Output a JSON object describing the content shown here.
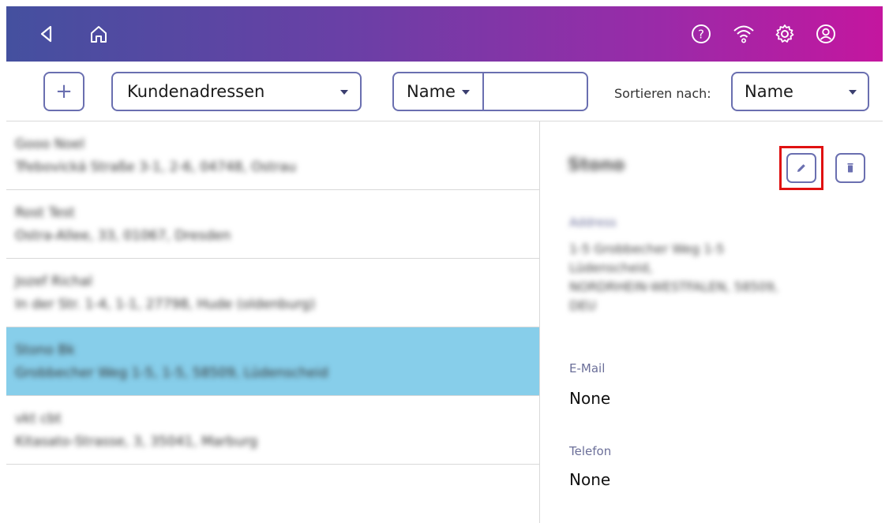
{
  "topbar": {
    "icons": [
      "back-icon",
      "home-icon",
      "help-icon",
      "wifi-icon",
      "settings-icon",
      "account-icon"
    ],
    "gradient": [
      "#44509f",
      "#c4169f"
    ]
  },
  "toolbar": {
    "add_label": "+",
    "address_book": "Kundenadressen",
    "search_field": "Name",
    "search_value": "",
    "sort_label": "Sortieren nach:",
    "sort_value": "Name"
  },
  "list": {
    "selected_index": 3,
    "selected_color": "#87ceea",
    "items": [
      {
        "name": "Gooo Noel",
        "address": "Třebovická Straße 3-1, 2-6, 04748, Ostrau"
      },
      {
        "name": "Rost Test",
        "address": "Ostra-Allee, 33, 01067, Dresden"
      },
      {
        "name": "Jozef Richal",
        "address": "In der Str. 1-4, 1-1, 27798, Hude (oldenburg)"
      },
      {
        "name": "Stono Bk",
        "address": "Grobbecher Weg 1-5, 1-5, 58509, Lüdenscheid"
      },
      {
        "name": "vkt cbt",
        "address": "Kitasato-Strasse, 3, 35041, Marburg"
      }
    ]
  },
  "detail": {
    "title": "Stono",
    "address_label": "Address",
    "address_lines": [
      "1-5 Grobbecher Weg 1-5",
      "Lüdenscheid,",
      "NORDRHEIN-WESTFALEN, 58509,",
      "DEU"
    ],
    "email_label": "E-Mail",
    "email_value": "None",
    "phone_label": "Telefon",
    "phone_value": "None",
    "highlight_color": "#e01111"
  }
}
